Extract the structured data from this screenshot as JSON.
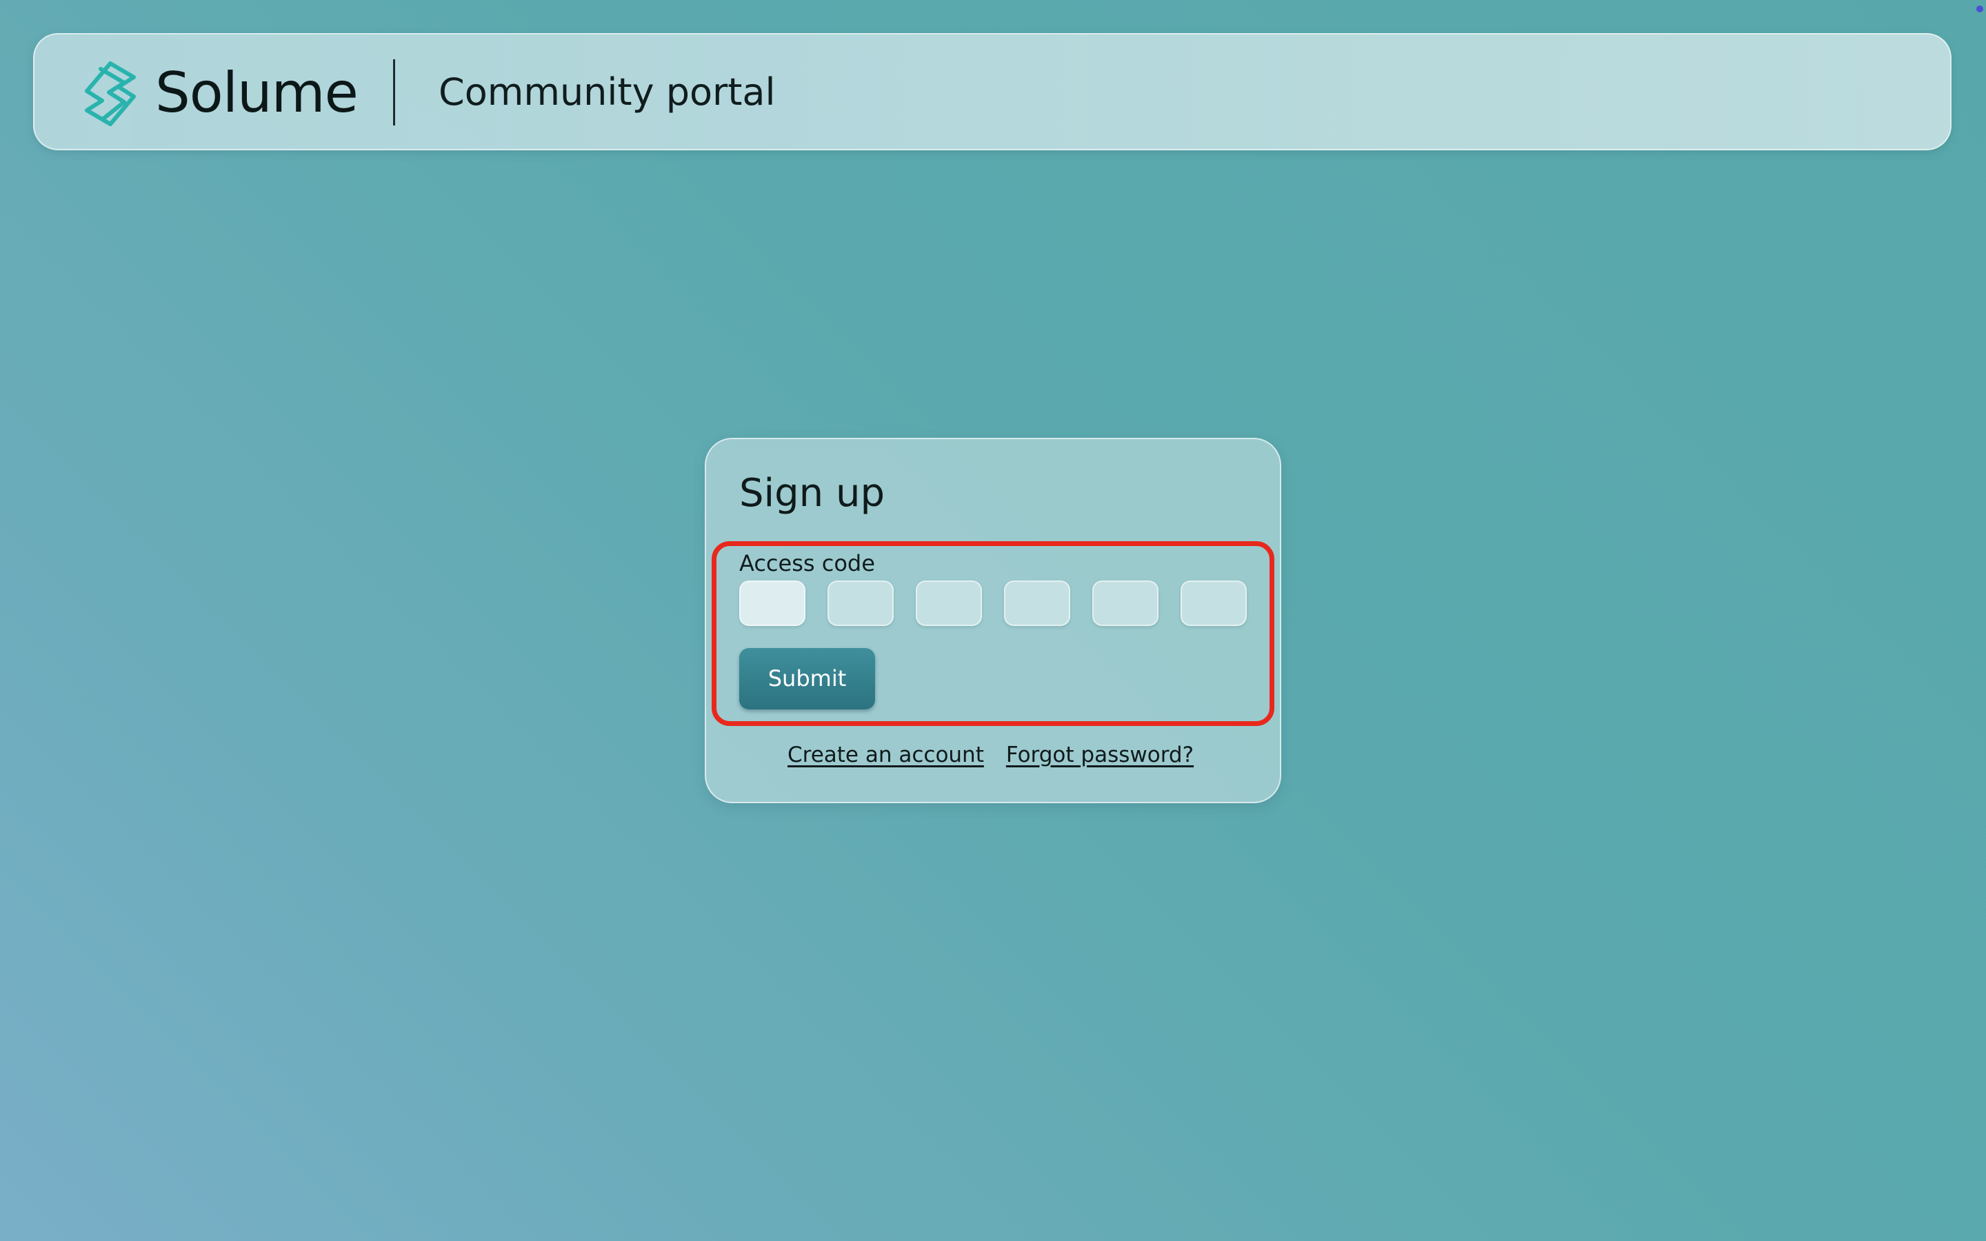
{
  "header": {
    "brand": "Solume",
    "portal_title": "Community portal",
    "logo_icon": "solume-logo-icon",
    "logo_color": "#2ab3ad"
  },
  "signup": {
    "title": "Sign up",
    "access_code_label": "Access code",
    "code_digits": [
      "",
      "",
      "",
      "",
      "",
      ""
    ],
    "submit_label": "Submit",
    "create_account_link": "Create an account",
    "forgot_password_link": "Forgot password?"
  },
  "colors": {
    "highlight_border": "#e8281c",
    "submit_button": "#2f7887"
  }
}
